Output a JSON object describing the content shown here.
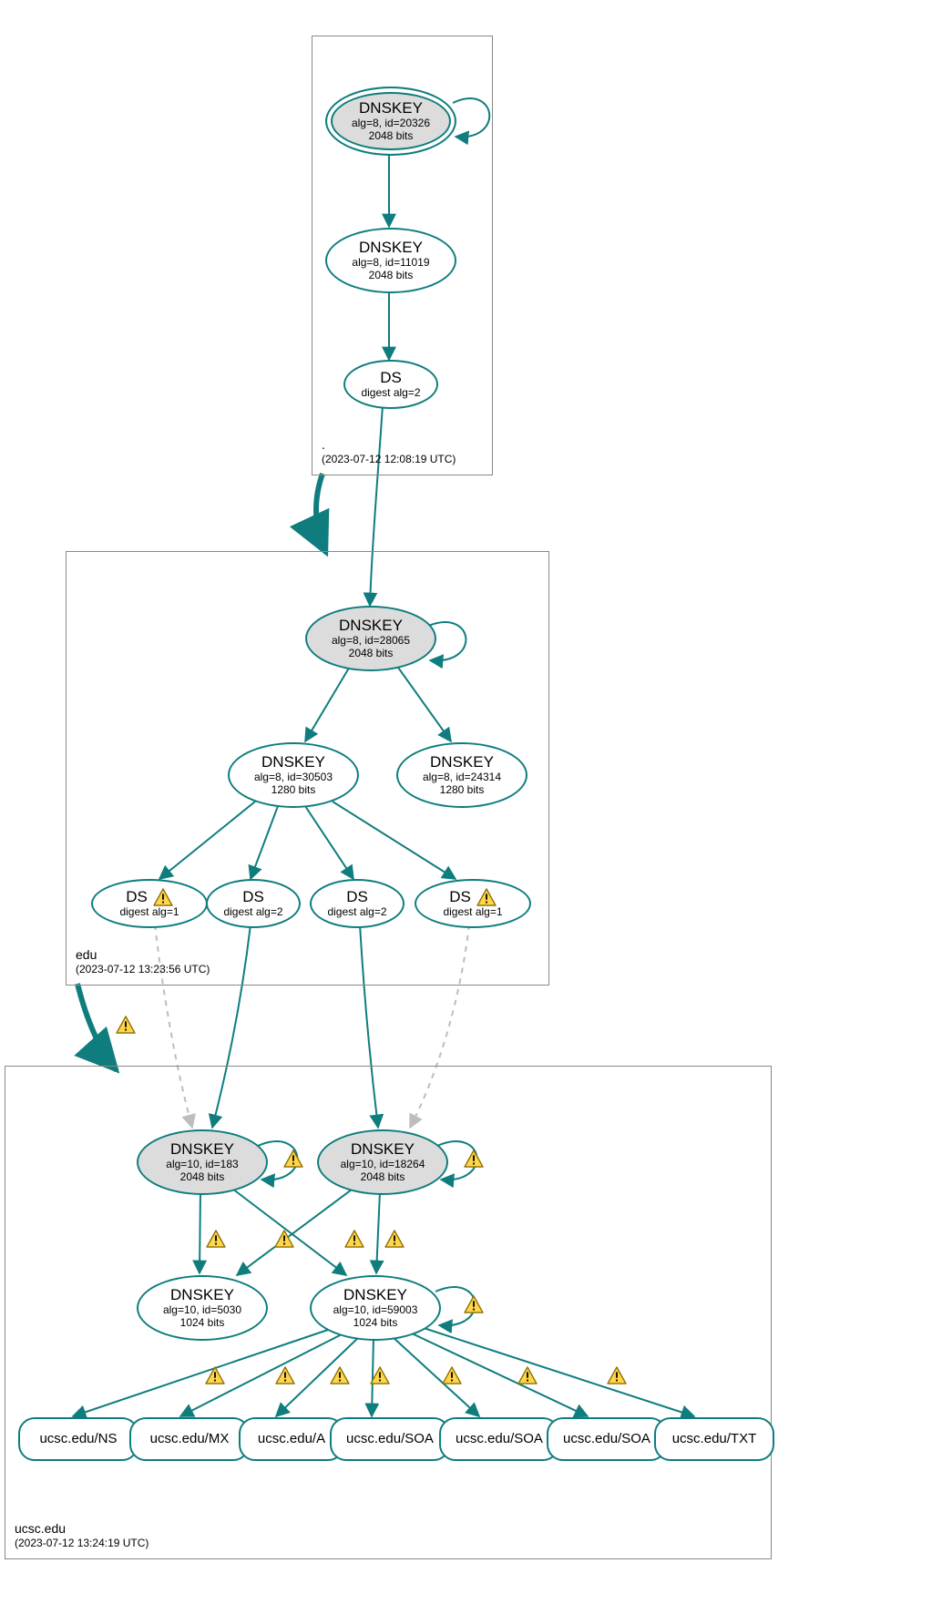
{
  "colors": {
    "stroke": "#0f7d7d",
    "grey": "#dcdcdc",
    "dashed": "#bdbdbd",
    "warn_fill": "#ffd54a",
    "warn_stroke": "#8a6d00"
  },
  "zones": {
    "root": {
      "domain": ".",
      "timestamp": "(2023-07-12 12:08:19 UTC)"
    },
    "edu": {
      "domain": "edu",
      "timestamp": "(2023-07-12 13:23:56 UTC)"
    },
    "ucsc": {
      "domain": "ucsc.edu",
      "timestamp": "(2023-07-12 13:24:19 UTC)"
    }
  },
  "nodes": {
    "root_dnskey1": {
      "title": "DNSKEY",
      "sub1": "alg=8, id=20326",
      "sub2": "2048 bits",
      "trust_anchor": true
    },
    "root_dnskey2": {
      "title": "DNSKEY",
      "sub1": "alg=8, id=11019",
      "sub2": "2048 bits"
    },
    "root_ds": {
      "title": "DS",
      "sub1": "digest alg=2"
    },
    "edu_dnskey1": {
      "title": "DNSKEY",
      "sub1": "alg=8, id=28065",
      "sub2": "2048 bits",
      "ksk": true
    },
    "edu_dnskey2": {
      "title": "DNSKEY",
      "sub1": "alg=8, id=30503",
      "sub2": "1280 bits"
    },
    "edu_dnskey3": {
      "title": "DNSKEY",
      "sub1": "alg=8, id=24314",
      "sub2": "1280 bits"
    },
    "edu_ds1": {
      "title": "DS",
      "sub1": "digest alg=1",
      "warn": true
    },
    "edu_ds2": {
      "title": "DS",
      "sub1": "digest alg=2"
    },
    "edu_ds3": {
      "title": "DS",
      "sub1": "digest alg=2"
    },
    "edu_ds4": {
      "title": "DS",
      "sub1": "digest alg=1",
      "warn": true
    },
    "ucsc_dnskey1": {
      "title": "DNSKEY",
      "sub1": "alg=10, id=183",
      "sub2": "2048 bits",
      "ksk": true
    },
    "ucsc_dnskey2": {
      "title": "DNSKEY",
      "sub1": "alg=10, id=18264",
      "sub2": "2048 bits",
      "ksk": true
    },
    "ucsc_dnskey3": {
      "title": "DNSKEY",
      "sub1": "alg=10, id=5030",
      "sub2": "1024 bits"
    },
    "ucsc_dnskey4": {
      "title": "DNSKEY",
      "sub1": "alg=10, id=59003",
      "sub2": "1024 bits"
    },
    "rr_ns": {
      "label": "ucsc.edu/NS"
    },
    "rr_mx": {
      "label": "ucsc.edu/MX"
    },
    "rr_a": {
      "label": "ucsc.edu/A"
    },
    "rr_soa1": {
      "label": "ucsc.edu/SOA"
    },
    "rr_soa2": {
      "label": "ucsc.edu/SOA"
    },
    "rr_soa3": {
      "label": "ucsc.edu/SOA"
    },
    "rr_txt": {
      "label": "ucsc.edu/TXT"
    }
  },
  "edges": [
    {
      "from": "root_dnskey1",
      "to": "root_dnskey1",
      "self": true
    },
    {
      "from": "root_dnskey1",
      "to": "root_dnskey2"
    },
    {
      "from": "root_dnskey2",
      "to": "root_ds"
    },
    {
      "from": "root_ds",
      "to": "edu_dnskey1"
    },
    {
      "from": "root_zone",
      "to": "edu_zone",
      "thick": true,
      "zone_link": true
    },
    {
      "from": "edu_dnskey1",
      "to": "edu_dnskey1",
      "self": true
    },
    {
      "from": "edu_dnskey1",
      "to": "edu_dnskey2"
    },
    {
      "from": "edu_dnskey1",
      "to": "edu_dnskey3"
    },
    {
      "from": "edu_dnskey2",
      "to": "edu_ds1"
    },
    {
      "from": "edu_dnskey2",
      "to": "edu_ds2"
    },
    {
      "from": "edu_dnskey2",
      "to": "edu_ds3"
    },
    {
      "from": "edu_dnskey2",
      "to": "edu_ds4"
    },
    {
      "from": "edu_zone",
      "to": "ucsc_zone",
      "thick": true,
      "zone_link": true,
      "warn": true
    },
    {
      "from": "edu_ds1",
      "to": "ucsc_dnskey1",
      "dashed": true
    },
    {
      "from": "edu_ds2",
      "to": "ucsc_dnskey1"
    },
    {
      "from": "edu_ds3",
      "to": "ucsc_dnskey2"
    },
    {
      "from": "edu_ds4",
      "to": "ucsc_dnskey2",
      "dashed": true
    },
    {
      "from": "ucsc_dnskey1",
      "to": "ucsc_dnskey1",
      "self": true,
      "warn": true
    },
    {
      "from": "ucsc_dnskey2",
      "to": "ucsc_dnskey2",
      "self": true,
      "warn": true
    },
    {
      "from": "ucsc_dnskey1",
      "to": "ucsc_dnskey3",
      "warn": true
    },
    {
      "from": "ucsc_dnskey1",
      "to": "ucsc_dnskey4",
      "warn": true
    },
    {
      "from": "ucsc_dnskey2",
      "to": "ucsc_dnskey3",
      "warn": true
    },
    {
      "from": "ucsc_dnskey2",
      "to": "ucsc_dnskey4",
      "warn": true
    },
    {
      "from": "ucsc_dnskey4",
      "to": "ucsc_dnskey4",
      "self": true,
      "warn": true
    },
    {
      "from": "ucsc_dnskey4",
      "to": "rr_ns",
      "warn": true
    },
    {
      "from": "ucsc_dnskey4",
      "to": "rr_mx",
      "warn": true
    },
    {
      "from": "ucsc_dnskey4",
      "to": "rr_a",
      "warn": true
    },
    {
      "from": "ucsc_dnskey4",
      "to": "rr_soa1",
      "warn": true
    },
    {
      "from": "ucsc_dnskey4",
      "to": "rr_soa2",
      "warn": true
    },
    {
      "from": "ucsc_dnskey4",
      "to": "rr_soa3",
      "warn": true
    },
    {
      "from": "ucsc_dnskey4",
      "to": "rr_txt",
      "warn": true
    }
  ]
}
